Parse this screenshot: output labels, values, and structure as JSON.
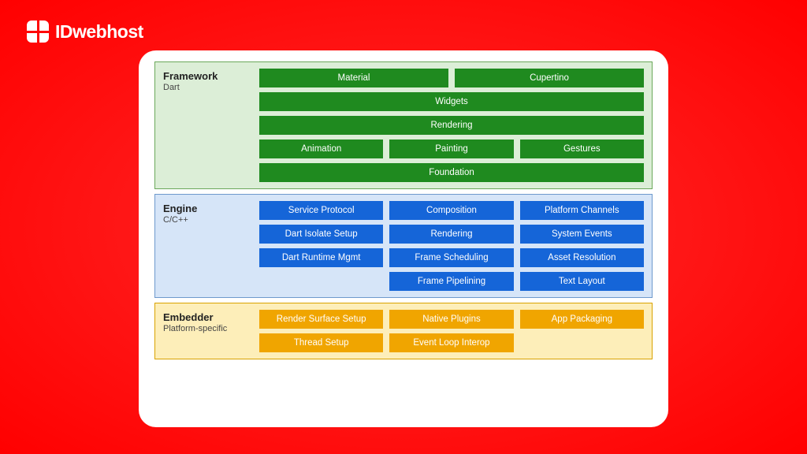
{
  "logo": {
    "text": "IDwebhost"
  },
  "framework": {
    "title": "Framework",
    "subtitle": "Dart",
    "row1": {
      "a": "Material",
      "b": "Cupertino"
    },
    "row2": "Widgets",
    "row3": "Rendering",
    "row4": {
      "a": "Animation",
      "b": "Painting",
      "c": "Gestures"
    },
    "row5": "Foundation"
  },
  "engine": {
    "title": "Engine",
    "subtitle": "C/C++",
    "row1": {
      "a": "Service Protocol",
      "b": "Composition",
      "c": "Platform Channels"
    },
    "row2": {
      "a": "Dart Isolate Setup",
      "b": "Rendering",
      "c": "System Events"
    },
    "row3": {
      "a": "Dart Runtime Mgmt",
      "b": "Frame Scheduling",
      "c": "Asset Resolution"
    },
    "row4": {
      "b": "Frame Pipelining",
      "c": "Text Layout"
    }
  },
  "embedder": {
    "title": "Embedder",
    "subtitle": "Platform-specific",
    "row1": {
      "a": "Render Surface Setup",
      "b": "Native Plugins",
      "c": "App Packaging"
    },
    "row2": {
      "a": "Thread Setup",
      "b": "Event Loop Interop"
    }
  }
}
